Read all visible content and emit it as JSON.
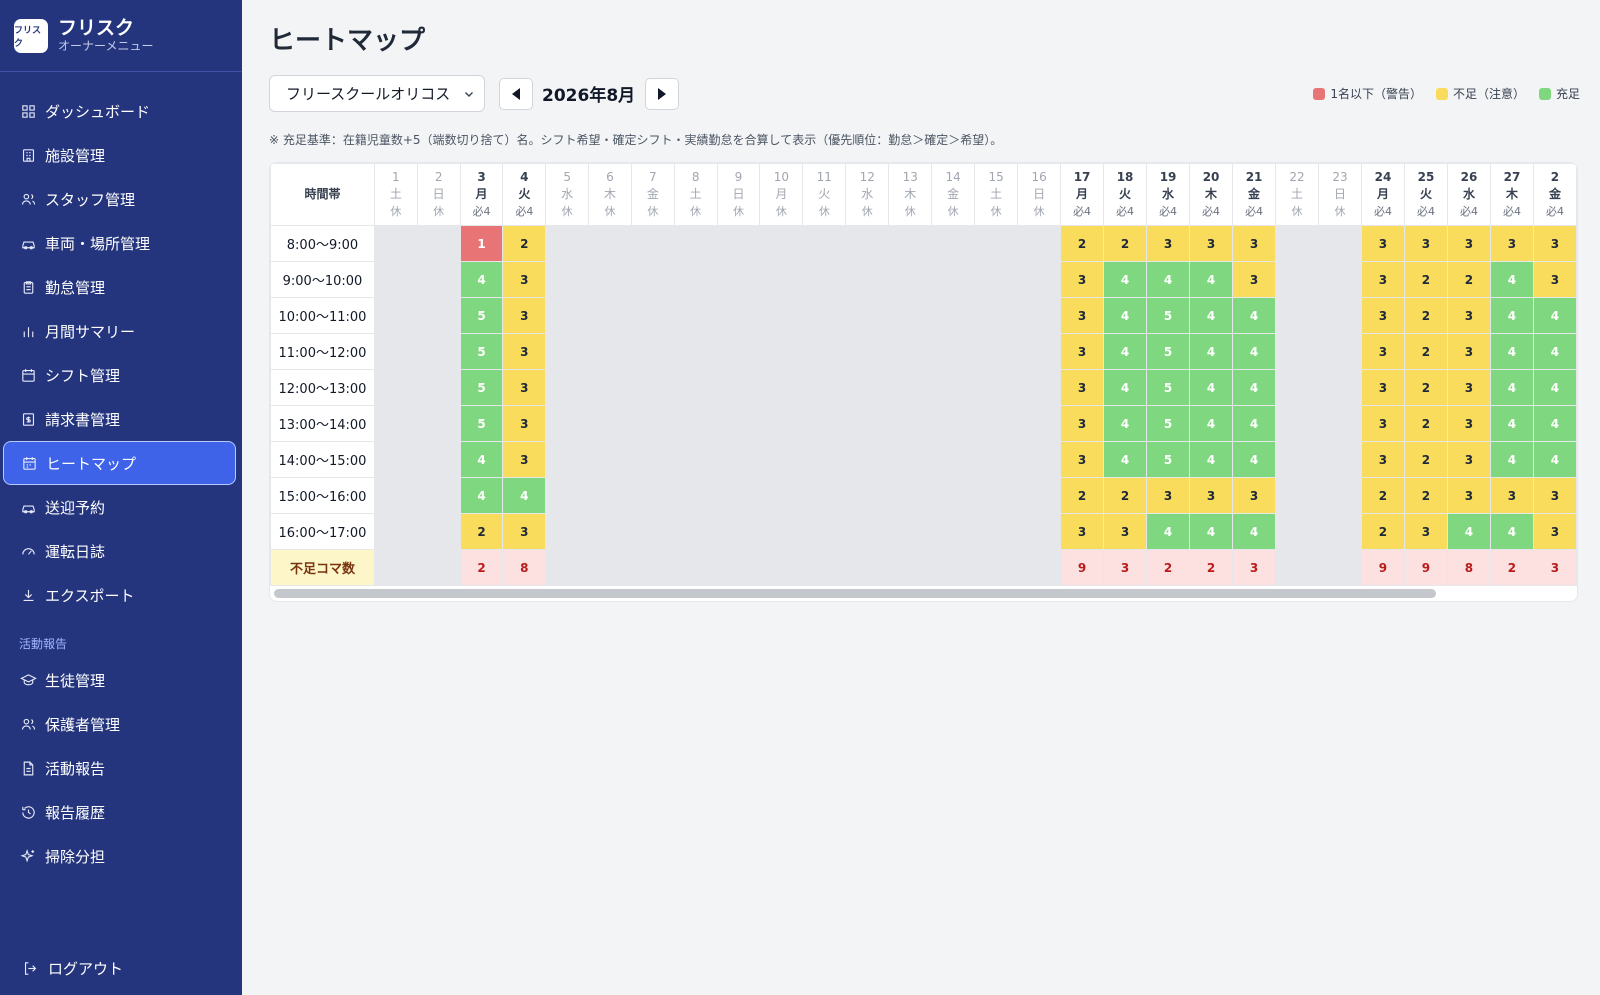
{
  "brand": {
    "logo_text": "フリスク",
    "title": "フリスク",
    "subtitle": "オーナーメニュー"
  },
  "sidebar": {
    "items": [
      {
        "label": "ダッシュボード",
        "icon": "dashboard-icon"
      },
      {
        "label": "施設管理",
        "icon": "building-icon"
      },
      {
        "label": "スタッフ管理",
        "icon": "users-icon"
      },
      {
        "label": "車両・場所管理",
        "icon": "car-icon"
      },
      {
        "label": "勤怠管理",
        "icon": "clipboard-icon"
      },
      {
        "label": "月間サマリー",
        "icon": "bar-chart-icon"
      },
      {
        "label": "シフト管理",
        "icon": "calendar-icon"
      },
      {
        "label": "請求書管理",
        "icon": "invoice-icon"
      },
      {
        "label": "ヒートマップ",
        "icon": "calendar-grid-icon",
        "active": true
      },
      {
        "label": "送迎予約",
        "icon": "car-icon"
      },
      {
        "label": "運転日誌",
        "icon": "gauge-icon"
      },
      {
        "label": "エクスポート",
        "icon": "download-icon"
      }
    ],
    "section_label": "活動報告",
    "section_items": [
      {
        "label": "生徒管理",
        "icon": "graduation-cap-icon"
      },
      {
        "label": "保護者管理",
        "icon": "users-icon"
      },
      {
        "label": "活動報告",
        "icon": "document-icon"
      },
      {
        "label": "報告履歴",
        "icon": "history-icon"
      },
      {
        "label": "掃除分担",
        "icon": "sparkle-icon"
      }
    ],
    "logout": "ログアウト"
  },
  "page": {
    "title": "ヒートマップ",
    "facility": "フリースクールオリコス",
    "month": "2026年8月",
    "note": "※ 充足基準：在籍児童数+5（端数切り捨て）名。シフト希望・確定シフト・実績勤怠を合算して表示（優先順位：勤怠＞確定＞希望）。"
  },
  "legend": [
    {
      "label": "1名以下（警告）",
      "color": "#e97476"
    },
    {
      "label": "不足（注意）",
      "color": "#f9dc5c"
    },
    {
      "label": "充足",
      "color": "#7fd87f"
    }
  ],
  "heatmap": {
    "corner_label": "時間帯",
    "shortage_label": "不足コマ数",
    "closed_label": "休",
    "days": [
      {
        "d": "1",
        "w": "土",
        "req": "休",
        "closed": true
      },
      {
        "d": "2",
        "w": "日",
        "req": "休",
        "closed": true
      },
      {
        "d": "3",
        "w": "月",
        "req": "必4"
      },
      {
        "d": "4",
        "w": "火",
        "req": "必4"
      },
      {
        "d": "5",
        "w": "水",
        "req": "休",
        "closed": true
      },
      {
        "d": "6",
        "w": "木",
        "req": "休",
        "closed": true
      },
      {
        "d": "7",
        "w": "金",
        "req": "休",
        "closed": true
      },
      {
        "d": "8",
        "w": "土",
        "req": "休",
        "closed": true
      },
      {
        "d": "9",
        "w": "日",
        "req": "休",
        "closed": true
      },
      {
        "d": "10",
        "w": "月",
        "req": "休",
        "closed": true
      },
      {
        "d": "11",
        "w": "火",
        "req": "休",
        "closed": true
      },
      {
        "d": "12",
        "w": "水",
        "req": "休",
        "closed": true
      },
      {
        "d": "13",
        "w": "木",
        "req": "休",
        "closed": true
      },
      {
        "d": "14",
        "w": "金",
        "req": "休",
        "closed": true
      },
      {
        "d": "15",
        "w": "土",
        "req": "休",
        "closed": true
      },
      {
        "d": "16",
        "w": "日",
        "req": "休",
        "closed": true
      },
      {
        "d": "17",
        "w": "月",
        "req": "必4"
      },
      {
        "d": "18",
        "w": "火",
        "req": "必4"
      },
      {
        "d": "19",
        "w": "水",
        "req": "必4"
      },
      {
        "d": "20",
        "w": "木",
        "req": "必4"
      },
      {
        "d": "21",
        "w": "金",
        "req": "必4"
      },
      {
        "d": "22",
        "w": "土",
        "req": "休",
        "closed": true
      },
      {
        "d": "23",
        "w": "日",
        "req": "休",
        "closed": true
      },
      {
        "d": "24",
        "w": "月",
        "req": "必4"
      },
      {
        "d": "25",
        "w": "火",
        "req": "必4"
      },
      {
        "d": "26",
        "w": "水",
        "req": "必4"
      },
      {
        "d": "27",
        "w": "木",
        "req": "必4"
      },
      {
        "d": "2",
        "w": "金",
        "req": "必4"
      }
    ],
    "slots": [
      "8:00〜9:00",
      "9:00〜10:00",
      "10:00〜11:00",
      "11:00〜12:00",
      "12:00〜13:00",
      "13:00〜14:00",
      "14:00〜15:00",
      "15:00〜16:00",
      "16:00〜17:00"
    ],
    "values": {
      "3": [
        1,
        4,
        5,
        5,
        5,
        5,
        4,
        4,
        2
      ],
      "4": [
        2,
        3,
        3,
        3,
        3,
        3,
        3,
        4,
        3
      ],
      "17": [
        2,
        3,
        3,
        3,
        3,
        3,
        3,
        2,
        3
      ],
      "18": [
        2,
        4,
        4,
        4,
        4,
        4,
        4,
        2,
        3
      ],
      "19": [
        3,
        4,
        5,
        5,
        5,
        5,
        5,
        3,
        4
      ],
      "20": [
        3,
        4,
        4,
        4,
        4,
        4,
        4,
        3,
        4
      ],
      "21": [
        3,
        3,
        4,
        4,
        4,
        4,
        4,
        3,
        4
      ],
      "24": [
        3,
        3,
        3,
        3,
        3,
        3,
        3,
        2,
        2
      ],
      "25": [
        3,
        2,
        2,
        2,
        2,
        2,
        2,
        2,
        3
      ],
      "26": [
        3,
        2,
        3,
        3,
        3,
        3,
        3,
        3,
        4
      ],
      "27": [
        3,
        4,
        4,
        4,
        4,
        4,
        4,
        3,
        4
      ],
      "28": [
        3,
        3,
        4,
        4,
        4,
        4,
        4,
        3,
        3
      ]
    },
    "shortage": {
      "3": 2,
      "4": 8,
      "17": 9,
      "18": 3,
      "19": 2,
      "20": 2,
      "21": 3,
      "24": 9,
      "25": 9,
      "26": 8,
      "27": 2,
      "28": 3
    },
    "thresholds": {
      "warn_max": 1,
      "ok_min": 4
    }
  }
}
